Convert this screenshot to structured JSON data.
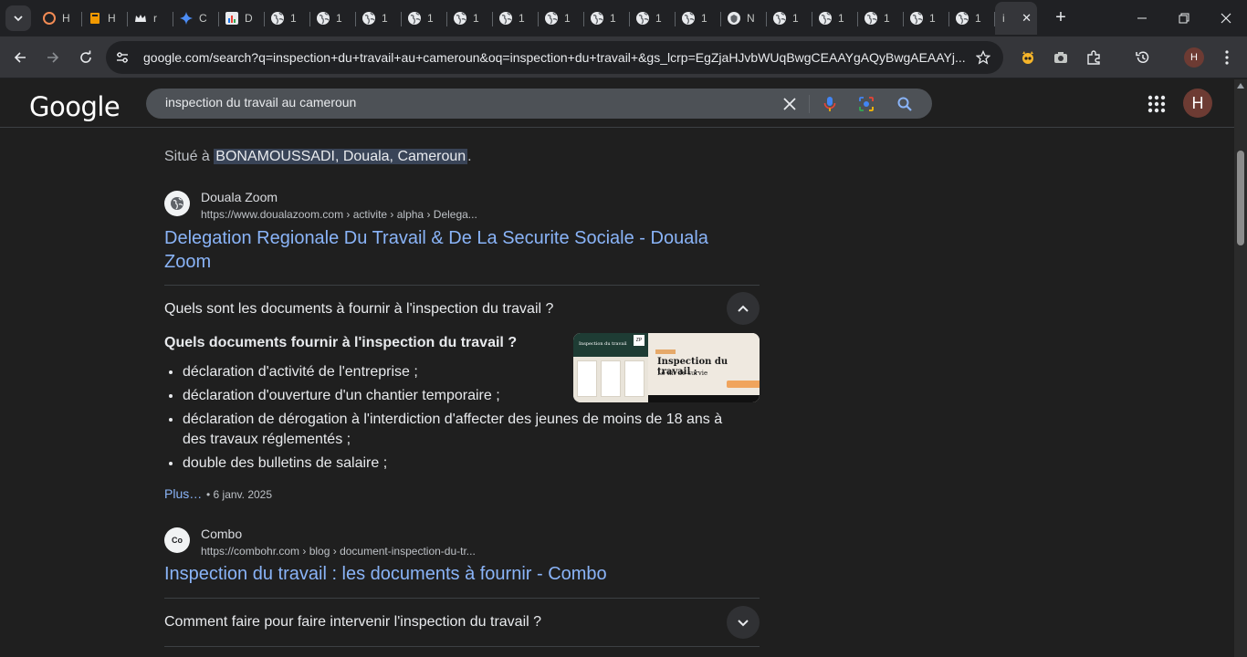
{
  "browser": {
    "tabs": [
      {
        "title": "H",
        "icon": "loader-ring-icon"
      },
      {
        "title": "H",
        "icon": "book-icon"
      },
      {
        "title": "r",
        "icon": "crown-icon"
      },
      {
        "title": "C",
        "icon": "sparkle-icon"
      },
      {
        "title": "D",
        "icon": "chart-icon"
      },
      {
        "title": "1",
        "icon": "globe-icon"
      },
      {
        "title": "1",
        "icon": "globe-icon"
      },
      {
        "title": "1",
        "icon": "globe-icon"
      },
      {
        "title": "1",
        "icon": "globe-icon"
      },
      {
        "title": "1",
        "icon": "globe-icon"
      },
      {
        "title": "1",
        "icon": "globe-icon"
      },
      {
        "title": "1",
        "icon": "globe-icon"
      },
      {
        "title": "1",
        "icon": "globe-icon"
      },
      {
        "title": "1",
        "icon": "globe-icon"
      },
      {
        "title": "1",
        "icon": "globe-icon"
      },
      {
        "title": "N",
        "icon": "shield-icon"
      },
      {
        "title": "1",
        "icon": "globe-icon"
      },
      {
        "title": "1",
        "icon": "globe-icon"
      },
      {
        "title": "1",
        "icon": "globe-icon"
      },
      {
        "title": "1",
        "icon": "globe-icon"
      },
      {
        "title": "1",
        "icon": "globe-icon"
      }
    ],
    "active_tab": {
      "title": "i"
    },
    "url": "google.com/search?q=inspection+du+travail+au+cameroun&oq=inspection+du+travail+&gs_lcrp=EgZjaHJvbWUqBwgCEAAYgAQyBwgAEAAYj...",
    "profile_initial": "H"
  },
  "google": {
    "logo": "Google",
    "query": "inspection du travail au cameroun",
    "profile_initial": "H"
  },
  "results": {
    "located_prefix": "Situé à ",
    "located_place": "BONAMOUSSADI, Douala, Cameroun",
    "located_suffix": ".",
    "source1": {
      "name": "Douala Zoom",
      "url": "https://www.doualazoom.com › activite › alpha › Delega...",
      "title": "Delegation Regionale Du Travail & De La Securite Sociale - Douala Zoom"
    },
    "faq1": {
      "question": "Quels sont les documents à fournir à l'inspection du travail ?",
      "answer_title": "Quels documents fournir à l'inspection du travail ?",
      "items": [
        "déclaration d'activité de l'entreprise ;",
        "déclaration d'ouverture d'un chantier temporaire ;",
        "déclaration de dérogation à l'interdiction d'affecter des jeunes de moins de 18 ans à des travaux réglementés ;",
        "double des bulletins de salaire ;"
      ],
      "more": "Plus…",
      "date": "• 6 janv. 2025",
      "thumb_title": "Inspection du travail :",
      "thumb_sub": "Le kit de survie"
    },
    "source2": {
      "name": "Combo",
      "url": "https://combohr.com › blog › document-inspection-du-tr...",
      "title": "Inspection du travail : les documents à fournir - Combo",
      "fav_text": "Co"
    },
    "faq2": {
      "question": "Comment faire pour faire intervenir l'inspection du travail ?"
    }
  }
}
